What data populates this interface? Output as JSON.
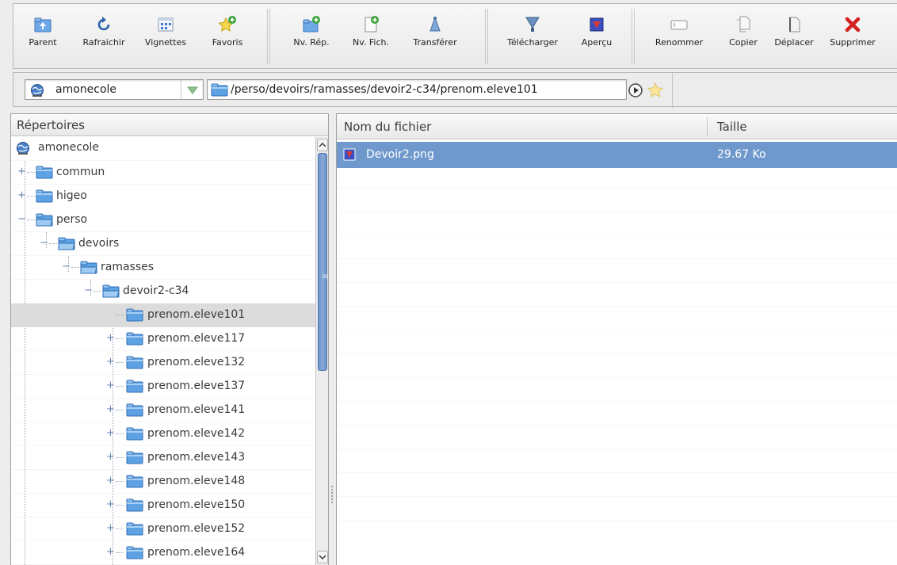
{
  "toolbar": {
    "buttons": [
      {
        "label": "Parent",
        "icon": "folder-up-icon"
      },
      {
        "label": "Rafraichir",
        "icon": "refresh-icon"
      },
      {
        "label": "Vignettes",
        "icon": "thumbnails-icon"
      },
      {
        "label": "Favoris",
        "icon": "star-add-icon"
      },
      {
        "label": "Nv. Rép.",
        "icon": "new-folder-icon"
      },
      {
        "label": "Nv. Fich.",
        "icon": "new-file-icon"
      },
      {
        "label": "Transférer",
        "icon": "upload-icon"
      },
      {
        "label": "Télécharger",
        "icon": "download-icon"
      },
      {
        "label": "Aperçu",
        "icon": "preview-icon"
      },
      {
        "label": "Renommer",
        "icon": "rename-icon"
      },
      {
        "label": "Copier",
        "icon": "copy-icon"
      },
      {
        "label": "Déplacer",
        "icon": "move-icon"
      },
      {
        "label": "Supprimer",
        "icon": "delete-icon"
      }
    ]
  },
  "location": {
    "server": "amonecole",
    "path": "/perso/devoirs/ramasses/devoir2-c34/prenom.eleve101"
  },
  "tree": {
    "header": "Répertoires",
    "items": [
      {
        "label": "amonecole",
        "expander": ""
      },
      {
        "label": "commun",
        "expander": "+"
      },
      {
        "label": "higeo",
        "expander": "+"
      },
      {
        "label": "perso",
        "expander": "−"
      },
      {
        "label": "devoirs",
        "expander": "−"
      },
      {
        "label": "ramasses",
        "expander": "−"
      },
      {
        "label": "devoir2-c34",
        "expander": "−"
      },
      {
        "label": "prenom.eleve101",
        "expander": ""
      },
      {
        "label": "prenom.eleve117",
        "expander": "+"
      },
      {
        "label": "prenom.eleve132",
        "expander": "+"
      },
      {
        "label": "prenom.eleve137",
        "expander": "+"
      },
      {
        "label": "prenom.eleve141",
        "expander": "+"
      },
      {
        "label": "prenom.eleve142",
        "expander": "+"
      },
      {
        "label": "prenom.eleve143",
        "expander": "+"
      },
      {
        "label": "prenom.eleve148",
        "expander": "+"
      },
      {
        "label": "prenom.eleve150",
        "expander": "+"
      },
      {
        "label": "prenom.eleve152",
        "expander": "+"
      },
      {
        "label": "prenom.eleve164",
        "expander": "+"
      }
    ]
  },
  "files": {
    "columns": {
      "name": "Nom du fichier",
      "size": "Taille"
    },
    "rows": [
      {
        "name": "Devoir2.png",
        "size": "29.67 Ko"
      }
    ]
  },
  "colors": {
    "selection": "#6f98cc",
    "tree_selection": "#dcdcdc",
    "folder": "#5a9be0"
  }
}
